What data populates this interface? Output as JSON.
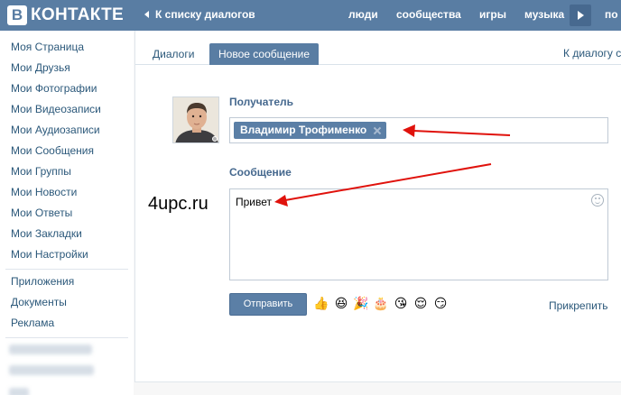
{
  "header": {
    "logo_letter": "В",
    "logo_text": "КОНТАКТЕ",
    "back_link": "К списку диалогов",
    "nav": [
      "люди",
      "сообщества",
      "игры",
      "музыка",
      "по"
    ]
  },
  "sidebar": {
    "items": [
      "Моя Страница",
      "Мои Друзья",
      "Мои Фотографии",
      "Мои Видеозаписи",
      "Мои Аудиозаписи",
      "Мои Сообщения",
      "Мои Группы",
      "Мои Новости",
      "Мои Ответы",
      "Мои Закладки",
      "Мои Настройки"
    ],
    "extra": [
      "Приложения",
      "Документы",
      "Реклама"
    ]
  },
  "tabs": {
    "dialogs": "Диалоги",
    "new_message": "Новое сообщение",
    "to_dialog": "К диалогу с"
  },
  "form": {
    "recipient_label": "Получатель",
    "recipient_name": "Владимир Трофименко",
    "message_label": "Сообщение",
    "message_text": "Привет",
    "send_label": "Отправить",
    "attach_label": "Прикрепить"
  },
  "emojis": [
    "👍",
    "😆",
    "🎉",
    "🎂",
    "😘",
    "😌",
    "😏"
  ],
  "watermark": "4upc.ru",
  "colors": {
    "brand": "#597da3",
    "link": "#2b587a",
    "arrow": "#e0120c"
  }
}
